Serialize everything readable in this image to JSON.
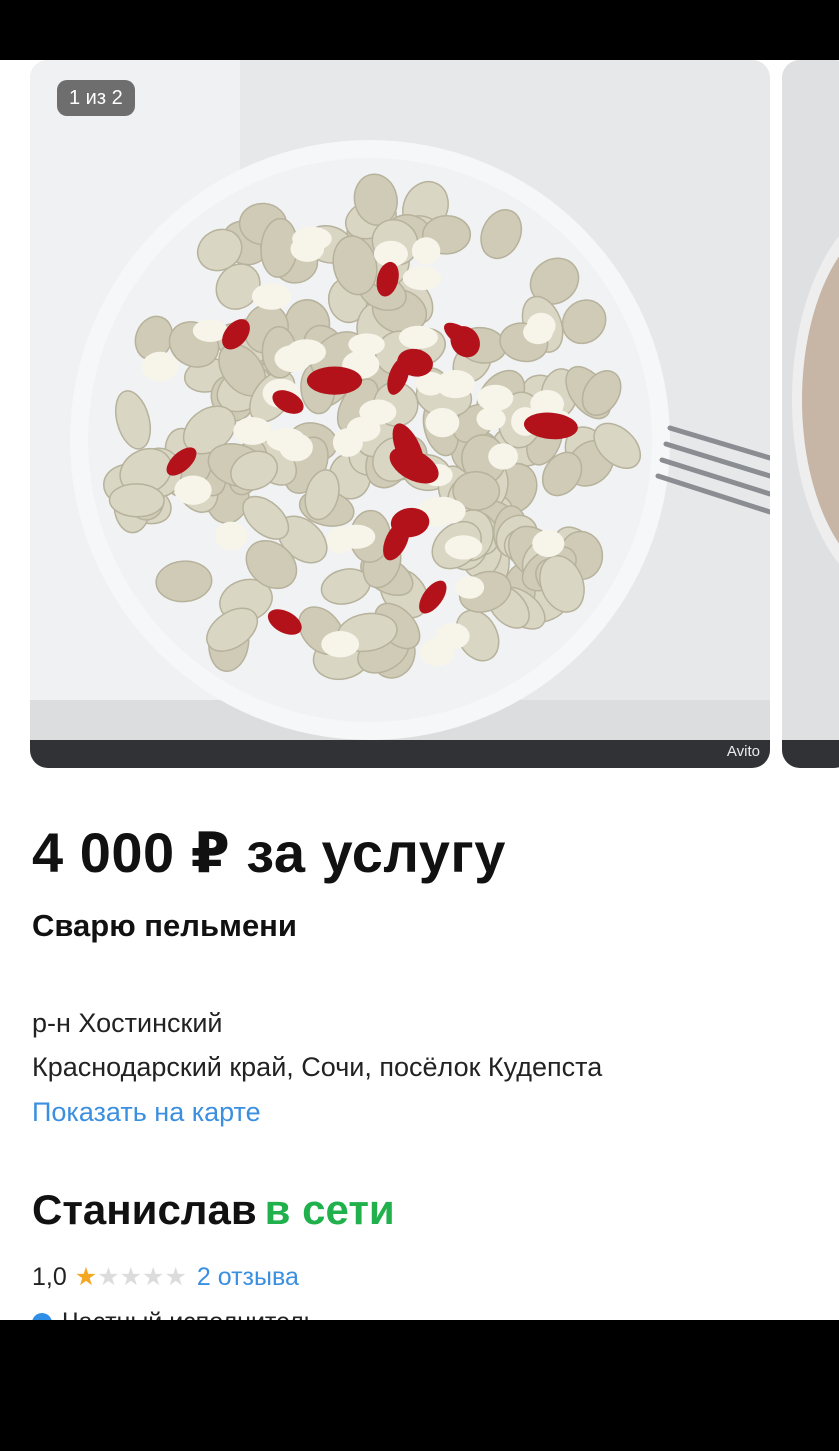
{
  "gallery": {
    "counter": "1 из 2",
    "watermark": "Avito"
  },
  "listing": {
    "price": "4 000 ₽ за услугу",
    "title": "Сварю пельмени",
    "district": "р-н Хостинский",
    "address": "Краснодарский край, Сочи, посёлок Кудепста",
    "map_link": "Показать на карте"
  },
  "seller": {
    "name": "Станислав",
    "status": "в сети",
    "rating": "1,0",
    "stars_filled": 1,
    "stars_total": 5,
    "reviews": "2 отзыва",
    "type": "Частный исполнитель"
  },
  "colors": {
    "link": "#3b8fe0",
    "online": "#20b14c",
    "star": "#f5a623"
  }
}
